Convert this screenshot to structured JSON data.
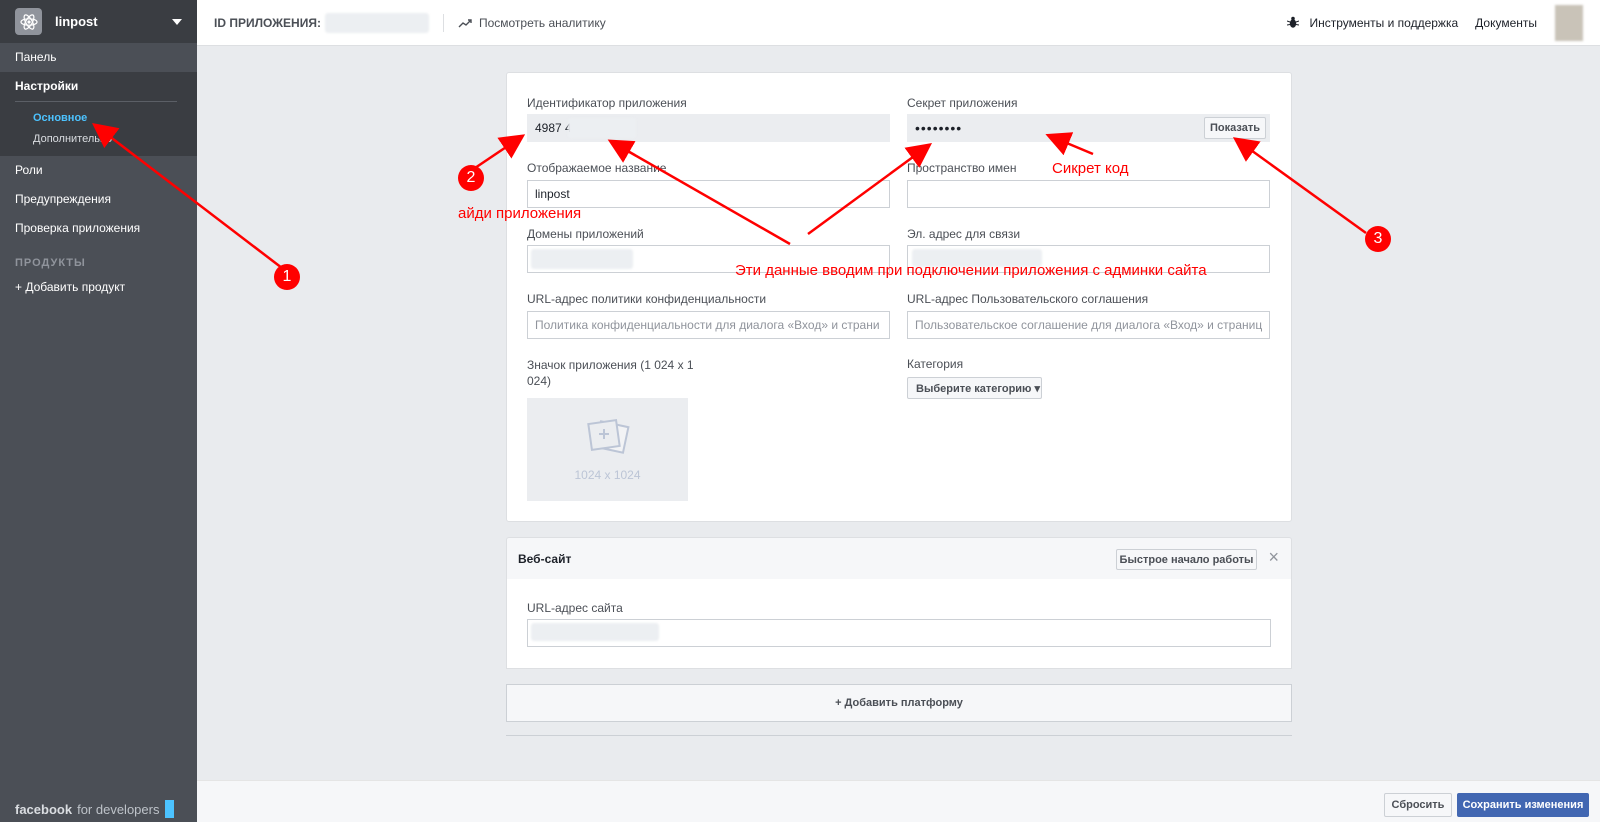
{
  "sidebar": {
    "app_name": "linpost",
    "items": {
      "panel": "Панель",
      "settings": "Настройки",
      "settings_basic": "Основное",
      "settings_advanced": "Дополнительно",
      "roles": "Роли",
      "alerts": "Предупреждения",
      "review": "Проверка приложения"
    },
    "products_heading": "ПРОДУКТЫ",
    "add_product": "+ Добавить продукт",
    "footer_brand": "facebook",
    "footer_suffix": "for developers"
  },
  "topbar": {
    "app_id_label": "ID ПРИЛОЖЕНИЯ:",
    "analytics_link": "Посмотреть аналитику",
    "tools_link": "Инструменты и поддержка",
    "docs_link": "Документы"
  },
  "form": {
    "app_id_label": "Идентификатор приложения",
    "app_id_value": "4987           42",
    "app_secret_label": "Секрет приложения",
    "app_secret_value": "••••••••",
    "show_button": "Показать",
    "display_name_label": "Отображаемое название",
    "display_name_value": "linpost",
    "namespace_label": "Пространство имен",
    "domains_label": "Домены приложений",
    "contact_email_label": "Эл. адрес для связи",
    "privacy_label": "URL-адрес политики конфиденциальности",
    "privacy_placeholder": "Политика конфиденциальности для диалога «Вход» и страни",
    "terms_label": "URL-адрес Пользовательского соглашения",
    "terms_placeholder": "Пользовательское соглашение для диалога «Вход» и страниц",
    "icon_label": "Значок приложения (1 024 x 1 024)",
    "icon_size_text": "1024 x 1024",
    "category_label": "Категория",
    "category_button": "Выберите категорию ▾"
  },
  "website": {
    "title": "Веб-сайт",
    "quickstart_button": "Быстрое начало работы",
    "close_glyph": "×",
    "site_url_label": "URL-адрес сайта"
  },
  "add_platform": "+ Добавить платформу",
  "bottom": {
    "reset_button": "Сбросить",
    "save_button": "Сохранить изменения"
  },
  "annotations": {
    "app_id_note": "айди приложения",
    "secret_note": "Сикрет код",
    "main_note": "Эти данные вводим при подключении приложения с админки сайта",
    "badge_1": "1",
    "badge_2": "2",
    "badge_3": "3"
  },
  "colors": {
    "sidebar_bg": "#4b4f56",
    "accent_active": "#4cc3ff",
    "primary_button": "#4267b2",
    "annotation_red": "#ff0000"
  }
}
